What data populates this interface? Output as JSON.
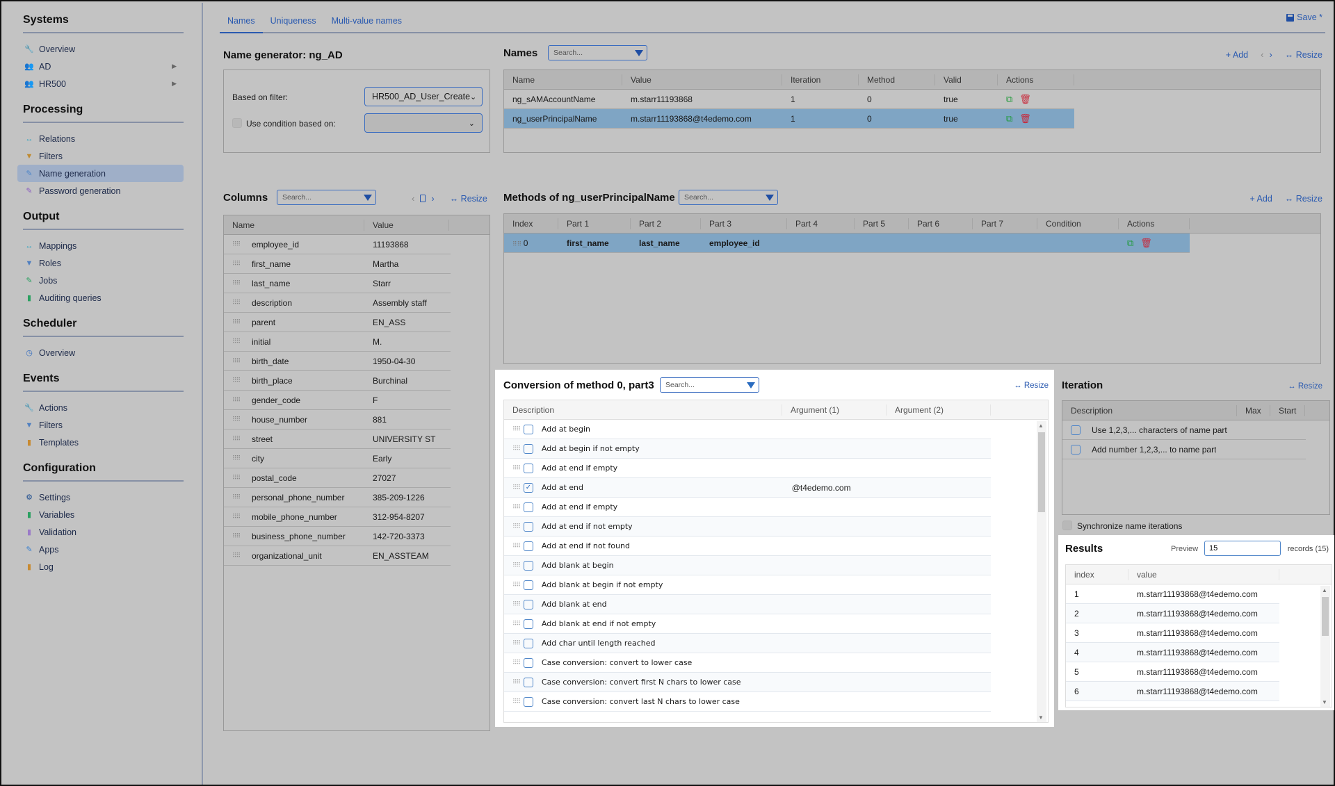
{
  "sidebar": {
    "sections": [
      {
        "title": "Systems",
        "items": [
          {
            "label": "Overview",
            "icon": "wrench-icon",
            "glyph": "🔧",
            "color": "#2d6fd0"
          },
          {
            "label": "AD",
            "icon": "users-icon",
            "glyph": "👥",
            "color": "#7a3fb0",
            "arrow": "▶"
          },
          {
            "label": "HR500",
            "icon": "users-icon",
            "glyph": "👥",
            "color": "#7a3fb0",
            "arrow": "▶"
          }
        ]
      },
      {
        "title": "Processing",
        "items": [
          {
            "label": "Relations",
            "icon": "arrows-icon",
            "glyph": "↔",
            "color": "#1a9ec0"
          },
          {
            "label": "Filters",
            "icon": "funnel-icon",
            "glyph": "▼",
            "color": "#c08a30"
          },
          {
            "label": "Name generation",
            "icon": "edit-doc-icon",
            "glyph": "✎",
            "color": "#4f86c9",
            "active": true
          },
          {
            "label": "Password generation",
            "icon": "edit-doc-icon",
            "glyph": "✎",
            "color": "#8a5cc0"
          }
        ]
      },
      {
        "title": "Output",
        "items": [
          {
            "label": "Mappings",
            "icon": "arrows-icon",
            "glyph": "↔",
            "color": "#1a9ec0"
          },
          {
            "label": "Roles",
            "icon": "funnel-icon",
            "glyph": "▼",
            "color": "#4f7fc0"
          },
          {
            "label": "Jobs",
            "icon": "edit-doc-icon",
            "glyph": "✎",
            "color": "#2aa060"
          },
          {
            "label": "Auditing queries",
            "icon": "document-icon",
            "glyph": "▮",
            "color": "#2aa060"
          }
        ]
      },
      {
        "title": "Scheduler",
        "items": [
          {
            "label": "Overview",
            "icon": "clock-icon",
            "glyph": "◷",
            "color": "#3a70c0"
          }
        ]
      },
      {
        "title": "Events",
        "items": [
          {
            "label": "Actions",
            "icon": "wrench-icon",
            "glyph": "🔧",
            "color": "#8a5cc0"
          },
          {
            "label": "Filters",
            "icon": "funnel-icon",
            "glyph": "▼",
            "color": "#4f7fc0"
          },
          {
            "label": "Templates",
            "icon": "document-icon",
            "glyph": "▮",
            "color": "#c88a30"
          }
        ]
      },
      {
        "title": "Configuration",
        "items": [
          {
            "label": "Settings",
            "icon": "gear-icon",
            "glyph": "⚙",
            "color": "#1f4e90"
          },
          {
            "label": "Variables",
            "icon": "document-icon",
            "glyph": "▮",
            "color": "#2aa060"
          },
          {
            "label": "Validation",
            "icon": "document-icon",
            "glyph": "▮",
            "color": "#9a7ac8"
          },
          {
            "label": "Apps",
            "icon": "edit-doc-icon",
            "glyph": "✎",
            "color": "#3a80d0"
          },
          {
            "label": "Log",
            "icon": "document-icon",
            "glyph": "▮",
            "color": "#c88a30"
          }
        ]
      }
    ]
  },
  "tabs": [
    {
      "label": "Names",
      "active": true
    },
    {
      "label": "Uniqueness"
    },
    {
      "label": "Multi-value names"
    }
  ],
  "save_label": "Save *",
  "common": {
    "search_placeholder": "Search...",
    "resize": "Resize",
    "add": "Add"
  },
  "generator": {
    "title": "Name generator: ng_AD",
    "filter_label": "Based on filter:",
    "filter_value": "HR500_AD_User_Create",
    "condition_label": "Use condition based on:",
    "condition_value": ""
  },
  "names": {
    "title": "Names",
    "columns": [
      "Name",
      "Value",
      "Iteration",
      "Method",
      "Valid",
      "Actions"
    ],
    "rows": [
      {
        "name": "ng_sAMAccountName",
        "value": "m.starr11193868",
        "iteration": "1",
        "method": "0",
        "valid": "true"
      },
      {
        "name": "ng_userPrincipalName",
        "value": "m.starr11193868@t4edemo.com",
        "iteration": "1",
        "method": "0",
        "valid": "true",
        "selected": true
      }
    ]
  },
  "columns_panel": {
    "title": "Columns",
    "headers": [
      "Name",
      "Value"
    ],
    "rows": [
      {
        "name": "employee_id",
        "value": "11193868"
      },
      {
        "name": "first_name",
        "value": "Martha"
      },
      {
        "name": "last_name",
        "value": "Starr"
      },
      {
        "name": "description",
        "value": "Assembly staff"
      },
      {
        "name": "parent",
        "value": "EN_ASS"
      },
      {
        "name": "initial",
        "value": "M."
      },
      {
        "name": "birth_date",
        "value": "1950-04-30"
      },
      {
        "name": "birth_place",
        "value": "Burchinal"
      },
      {
        "name": "gender_code",
        "value": "F"
      },
      {
        "name": "house_number",
        "value": "881"
      },
      {
        "name": "street",
        "value": "UNIVERSITY ST"
      },
      {
        "name": "city",
        "value": "Early"
      },
      {
        "name": "postal_code",
        "value": "27027"
      },
      {
        "name": "personal_phone_number",
        "value": "385-209-1226"
      },
      {
        "name": "mobile_phone_number",
        "value": "312-954-8207"
      },
      {
        "name": "business_phone_number",
        "value": "142-720-3373"
      },
      {
        "name": "organizational_unit",
        "value": "EN_ASSTEAM"
      }
    ]
  },
  "methods": {
    "title": "Methods of ng_userPrincipalName",
    "columns": [
      "Index",
      "Part 1",
      "Part 2",
      "Part 3",
      "Part 4",
      "Part 5",
      "Part 6",
      "Part 7",
      "Condition",
      "Actions"
    ],
    "rows": [
      {
        "index": "0",
        "parts": [
          "first_name",
          "last_name",
          "employee_id",
          "",
          "",
          "",
          ""
        ],
        "condition": "",
        "selected": true
      }
    ]
  },
  "conversion": {
    "title": "Conversion of method 0, part3",
    "columns": [
      "Description",
      "Argument (1)",
      "Argument (2)"
    ],
    "rows": [
      {
        "description": "Add at begin",
        "checked": false,
        "arg1": "",
        "arg2": ""
      },
      {
        "description": "Add at begin if not empty",
        "checked": false,
        "arg1": "",
        "arg2": ""
      },
      {
        "description": "Add at end if empty",
        "checked": false,
        "arg1": "",
        "arg2": ""
      },
      {
        "description": "Add at end",
        "checked": true,
        "arg1": "@t4edemo.com",
        "arg2": ""
      },
      {
        "description": "Add at end if empty",
        "checked": false,
        "arg1": "",
        "arg2": ""
      },
      {
        "description": "Add at end if not empty",
        "checked": false,
        "arg1": "",
        "arg2": ""
      },
      {
        "description": "Add at end if not found",
        "checked": false,
        "arg1": "",
        "arg2": ""
      },
      {
        "description": "Add blank at begin",
        "checked": false,
        "arg1": "",
        "arg2": ""
      },
      {
        "description": "Add blank at begin if not empty",
        "checked": false,
        "arg1": "",
        "arg2": ""
      },
      {
        "description": "Add blank at end",
        "checked": false,
        "arg1": "",
        "arg2": ""
      },
      {
        "description": "Add blank at end if not empty",
        "checked": false,
        "arg1": "",
        "arg2": ""
      },
      {
        "description": "Add char until length reached",
        "checked": false,
        "arg1": "",
        "arg2": ""
      },
      {
        "description": "Case conversion: convert to lower case",
        "checked": false,
        "arg1": "",
        "arg2": ""
      },
      {
        "description": "Case conversion: convert first N chars to lower case",
        "checked": false,
        "arg1": "",
        "arg2": ""
      },
      {
        "description": "Case conversion: convert last N chars to lower case",
        "checked": false,
        "arg1": "",
        "arg2": ""
      }
    ]
  },
  "iteration": {
    "title": "Iteration",
    "columns": [
      "Description",
      "Max",
      "Start"
    ],
    "rows": [
      {
        "description": "Use 1,2,3,... characters of name part",
        "checked": false
      },
      {
        "description": "Add number 1,2,3,... to name part",
        "checked": false
      }
    ],
    "sync_label": "Synchronize name iterations"
  },
  "results": {
    "title": "Results",
    "preview_label": "Preview",
    "preview_value": "15",
    "records_label": "records (15)",
    "columns": [
      "index",
      "value"
    ],
    "rows": [
      {
        "index": "1",
        "value": "m.starr11193868@t4edemo.com"
      },
      {
        "index": "2",
        "value": "m.starr11193868@t4edemo.com"
      },
      {
        "index": "3",
        "value": "m.starr11193868@t4edemo.com"
      },
      {
        "index": "4",
        "value": "m.starr11193868@t4edemo.com"
      },
      {
        "index": "5",
        "value": "m.starr11193868@t4edemo.com"
      },
      {
        "index": "6",
        "value": "m.starr11193868@t4edemo.com"
      }
    ]
  }
}
